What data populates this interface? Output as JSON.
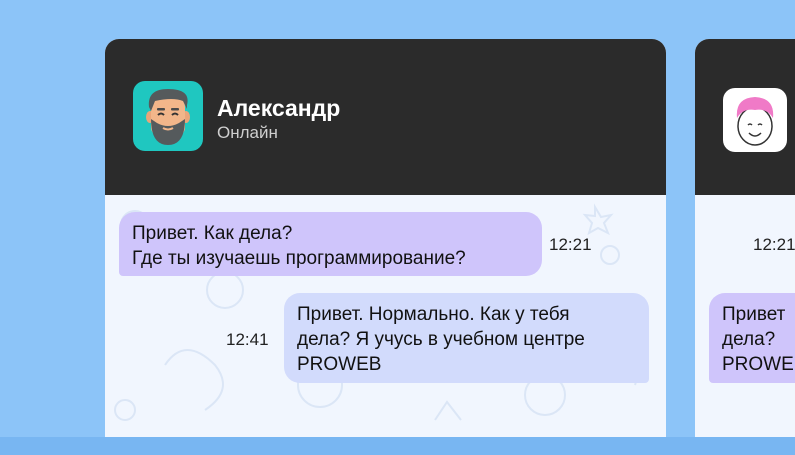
{
  "chat": {
    "contact_name": "Александр",
    "contact_status": "Онлайн",
    "messages": [
      {
        "direction": "incoming",
        "lines": [
          "Привет. Как дела?",
          "Где ты изучаешь программирование?"
        ],
        "time": "12:21"
      },
      {
        "direction": "outgoing",
        "lines": [
          "Привет. Нормально. Как у тебя",
          "дела? Я учусь в учебном центре",
          "PROWEB"
        ],
        "time": "12:41"
      }
    ]
  },
  "peek_chat": {
    "time": "12:21",
    "lines": [
      "Привет",
      "дела?",
      "PROWE"
    ]
  },
  "colors": {
    "background": "#8cc4f8",
    "header": "#2b2b2b",
    "chat_background": "#f1f6fe",
    "incoming_bubble": "#cfc5fb",
    "outgoing_bubble": "#d2dbfc",
    "avatar_teal": "#1fc7c0"
  }
}
